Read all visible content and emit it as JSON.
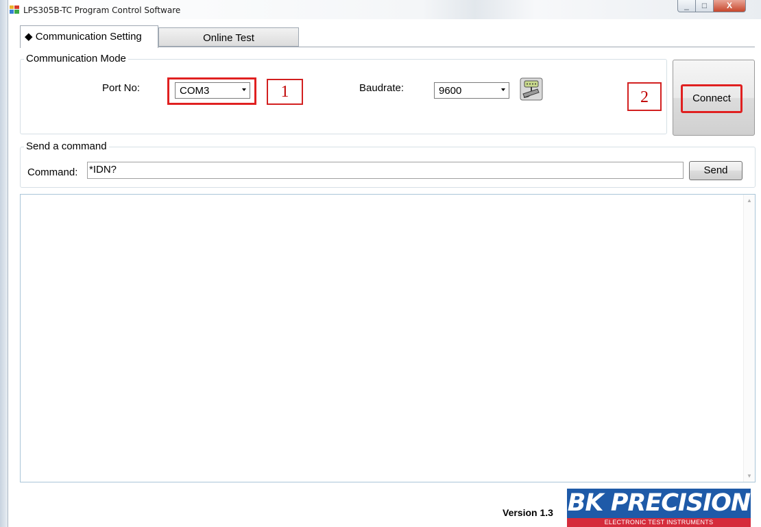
{
  "window": {
    "title": "LPS305B-TC Program Control Software",
    "controls": {
      "minimize": "_",
      "maximize": "□",
      "close": "X"
    }
  },
  "tabs": [
    {
      "label": "◆ Communication Setting",
      "active": true
    },
    {
      "label": "Online Test",
      "active": false
    }
  ],
  "communication_mode": {
    "legend": "Communication Mode",
    "port_label": "Port No:",
    "port_value": "COM3",
    "baud_label": "Baudrate:",
    "baud_value": "9600",
    "serial_icon": "serial-port-icon",
    "connect_label": "Connect"
  },
  "annotations": {
    "marker1": "1",
    "marker2": "2",
    "highlight_color": "#e02020"
  },
  "send_command": {
    "legend": "Send a command",
    "command_label": "Command:",
    "command_value": "*IDN?",
    "send_label": "Send"
  },
  "output": {
    "scroll_up": "▲",
    "scroll_down": "▼"
  },
  "footer": {
    "version": "Version 1.3",
    "brand": "BK PRECISION",
    "brand_sub": "ELECTRONIC TEST INSTRUMENTS",
    "brand_color": "#1e5aa8",
    "brand_accent": "#d52b3b"
  }
}
